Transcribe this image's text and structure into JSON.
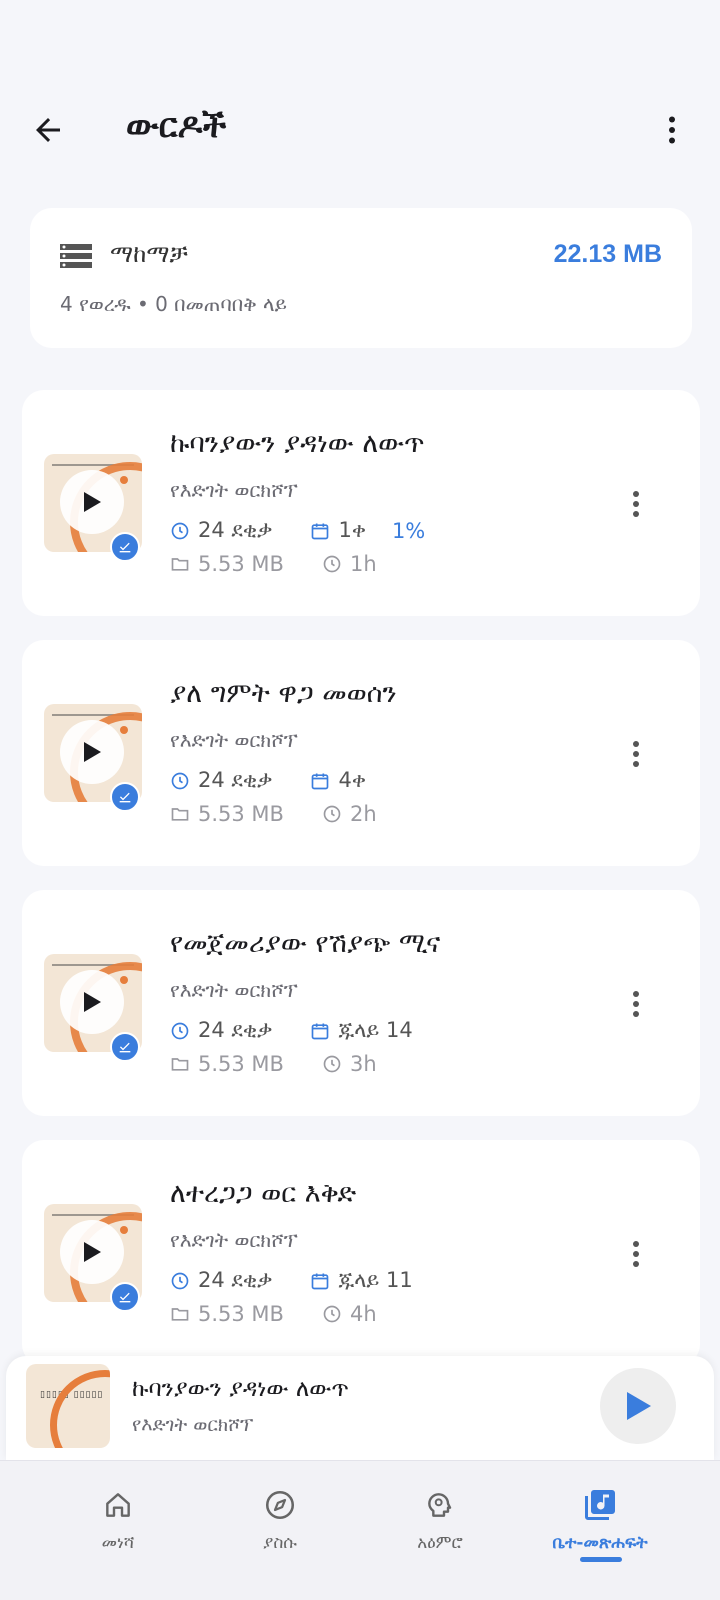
{
  "header": {
    "title": "ውርዶች",
    "back_icon": "arrow-left-icon",
    "more_icon": "more-vert-icon"
  },
  "storage": {
    "title": "ማከማቻ",
    "size": "22.13 MB",
    "subtitle": "4 የወረዱ • 0 በመጠባበቅ ላይ"
  },
  "episodes": [
    {
      "title": "ኩባንያውን ያዳነው ለውጥ",
      "author": "የእድገት ወርክሾፕ",
      "duration": "24 ደቂቃ",
      "date": "1ቀ",
      "progress": "1%",
      "file_size": "5.53 MB",
      "downloaded_ago": "1h"
    },
    {
      "title": "ያለ ግምት ዋጋ መወሰን",
      "author": "የእድገት ወርክሾፕ",
      "duration": "24 ደቂቃ",
      "date": "4ቀ",
      "progress": "",
      "file_size": "5.53 MB",
      "downloaded_ago": "2h"
    },
    {
      "title": "የመጀመሪያው የሽያጭ ሚና",
      "author": "የእድገት ወርክሾፕ",
      "duration": "24 ደቂቃ",
      "date": "ጁላይ 14",
      "progress": "",
      "file_size": "5.53 MB",
      "downloaded_ago": "3h"
    },
    {
      "title": "ለተረጋጋ ወር እቅድ",
      "author": "የእድገት ወርክሾፕ",
      "duration": "24 ደቂቃ",
      "date": "ጁላይ 11",
      "progress": "",
      "file_size": "5.53 MB",
      "downloaded_ago": "4h"
    }
  ],
  "mini_player": {
    "title": "ኩባንያውን ያዳነው ለውጥ",
    "author": "የእድገት ወርክሾፕ"
  },
  "bottom_nav": {
    "items": [
      {
        "label": "መነሻ",
        "icon": "home-icon",
        "active": false
      },
      {
        "label": "ያስሱ",
        "icon": "compass-icon",
        "active": false
      },
      {
        "label": "አዕምሮ",
        "icon": "brain-icon",
        "active": false
      },
      {
        "label": "ቤተ-መጽሐፍት",
        "icon": "library-music-icon",
        "active": true
      }
    ]
  },
  "colors": {
    "accent": "#3a7ddd",
    "background": "#f5f6fa",
    "card": "#ffffff",
    "thumb_orange": "#e67e3c"
  }
}
